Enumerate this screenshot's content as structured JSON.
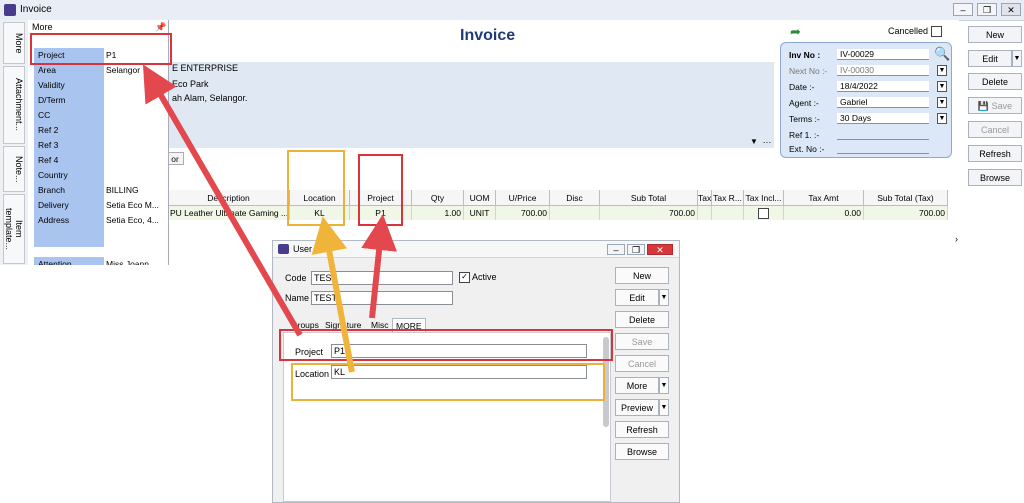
{
  "window": {
    "title": "Invoice"
  },
  "header": {
    "title": "Invoice",
    "cancelled_label": "Cancelled"
  },
  "side_tabs": [
    "More",
    "Attachment...",
    "Note...",
    "Item template..."
  ],
  "more_panel": {
    "header": "More",
    "fields": [
      {
        "label": "Project",
        "value": "P1"
      },
      {
        "label": "Area",
        "value": "Selangor"
      },
      {
        "label": "Validity",
        "value": ""
      },
      {
        "label": "D/Term",
        "value": ""
      },
      {
        "label": "CC",
        "value": ""
      },
      {
        "label": "Ref 2",
        "value": ""
      },
      {
        "label": "Ref 3",
        "value": ""
      },
      {
        "label": "Ref 4",
        "value": ""
      },
      {
        "label": "Country",
        "value": ""
      },
      {
        "label": "Branch",
        "value": "BILLING"
      },
      {
        "label": "Delivery",
        "value": "Setia Eco M..."
      },
      {
        "label": "Address",
        "value": "Setia Eco, 4..."
      },
      {
        "label": "Attention",
        "value": "Miss Joann"
      }
    ]
  },
  "customer": {
    "company": "E ENTERPRISE",
    "address1": "Eco Park",
    "address2": "ah Alam, Selangor.",
    "tab_stub": "or"
  },
  "doc_info": {
    "rows": [
      {
        "label": "Inv No :",
        "value": "IV-00029"
      },
      {
        "label": "Next No :-",
        "value": "IV-00030"
      },
      {
        "label": "Date :-",
        "value": "18/4/2022"
      },
      {
        "label": "Agent :-",
        "value": "Gabriel"
      },
      {
        "label": "Terms :-",
        "value": "30 Days"
      },
      {
        "label": "Ref 1. :-",
        "value": ""
      },
      {
        "label": "Ext. No :-",
        "value": ""
      }
    ]
  },
  "actions": {
    "new": "New",
    "edit": "Edit",
    "delete": "Delete",
    "save": "Save",
    "cancel": "Cancel",
    "refresh": "Refresh",
    "browse": "Browse"
  },
  "grid": {
    "columns": [
      "Description",
      "Location",
      "Project",
      "Qty",
      "UOM",
      "U/Price",
      "Disc",
      "Sub Total",
      "Tax",
      "Tax R...",
      "Tax Incl...",
      "Tax Amt",
      "Sub Total (Tax)"
    ],
    "row": {
      "description": "PU Leather Ultimate Gaming ...",
      "location": "KL",
      "project": "P1",
      "qty": "1.00",
      "uom": "UNIT",
      "uprice": "700.00",
      "disc": "",
      "subtotal": "700.00",
      "tax": "",
      "taxr": "",
      "taxamt": "0.00",
      "subtotal_tax": "700.00"
    }
  },
  "user_dialog": {
    "title": "User",
    "code_label": "Code",
    "code_value": "TEST",
    "active_label": "Active",
    "name_label": "Name",
    "name_value": "TEST",
    "tabs": [
      "Groups",
      "Signature",
      "Misc",
      "MORE"
    ],
    "project_label": "Project",
    "project_value": "P1",
    "location_label": "Location",
    "location_value": "KL",
    "buttons": {
      "new": "New",
      "edit": "Edit",
      "delete": "Delete",
      "save": "Save",
      "cancel": "Cancel",
      "more": "More",
      "preview": "Preview",
      "refresh": "Refresh",
      "browse": "Browse"
    }
  },
  "colors": {
    "title": "#1f3c78",
    "label_bg": "#a9c4ee",
    "info_bg": "#dce8f8",
    "red_annotation": "#d9343b",
    "yellow_annotation": "#eab23a"
  }
}
